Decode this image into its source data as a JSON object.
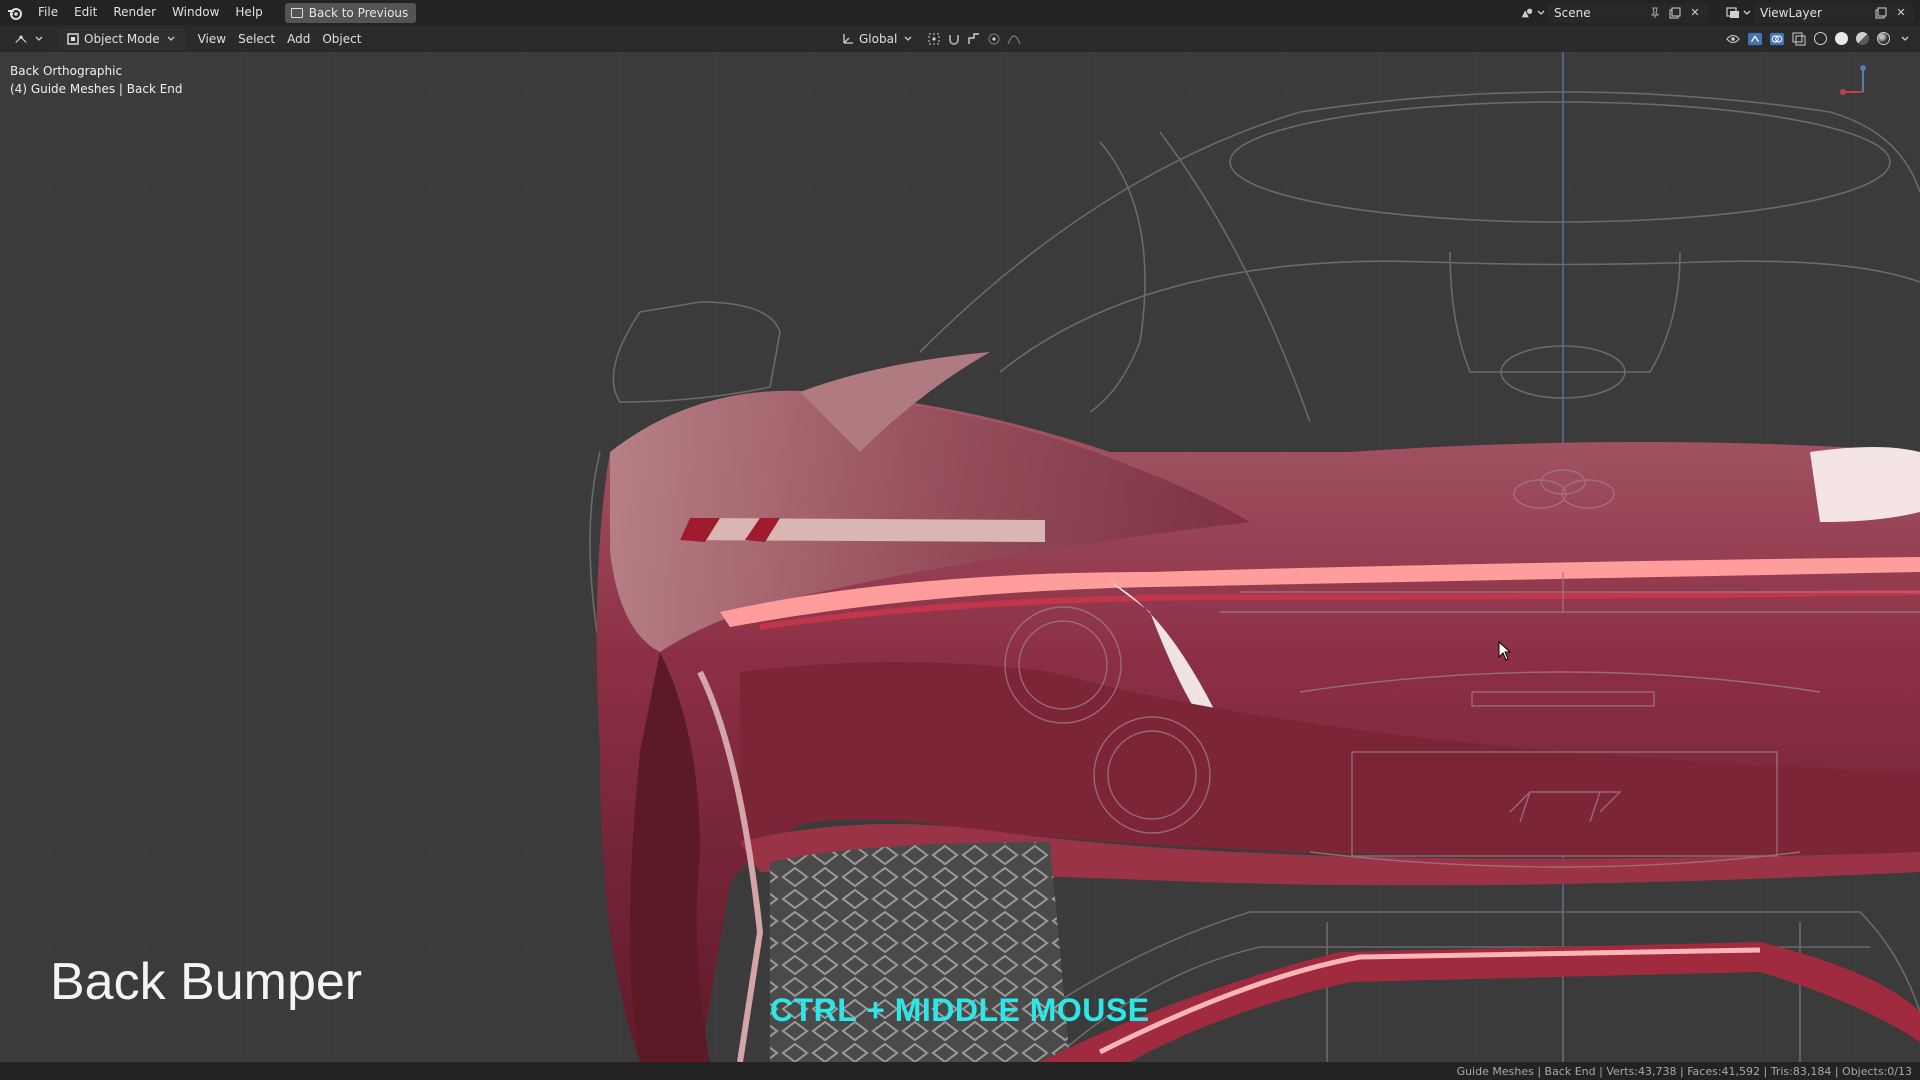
{
  "topbar": {
    "menus": [
      "File",
      "Edit",
      "Render",
      "Window",
      "Help"
    ],
    "back_button": "Back to Previous",
    "scene": "Scene",
    "view_layer": "ViewLayer"
  },
  "header": {
    "mode": "Object Mode",
    "menus": [
      "View",
      "Select",
      "Add",
      "Object"
    ],
    "transform_orientation": "Global"
  },
  "viewport": {
    "view_name": "Back Orthographic",
    "collection_info": "(4) Guide Meshes | Back End",
    "overlay_title": "Back Bumper",
    "shortcut_hint": "CTRL + MIDDLE MOUSE",
    "car_body_color": "#8c2f45",
    "grid_color": "#464646"
  },
  "statusbar": {
    "text": "Guide Meshes | Back End | Verts:43,738 | Faces:41,592 | Tris:83,184 | Objects:0/13"
  }
}
